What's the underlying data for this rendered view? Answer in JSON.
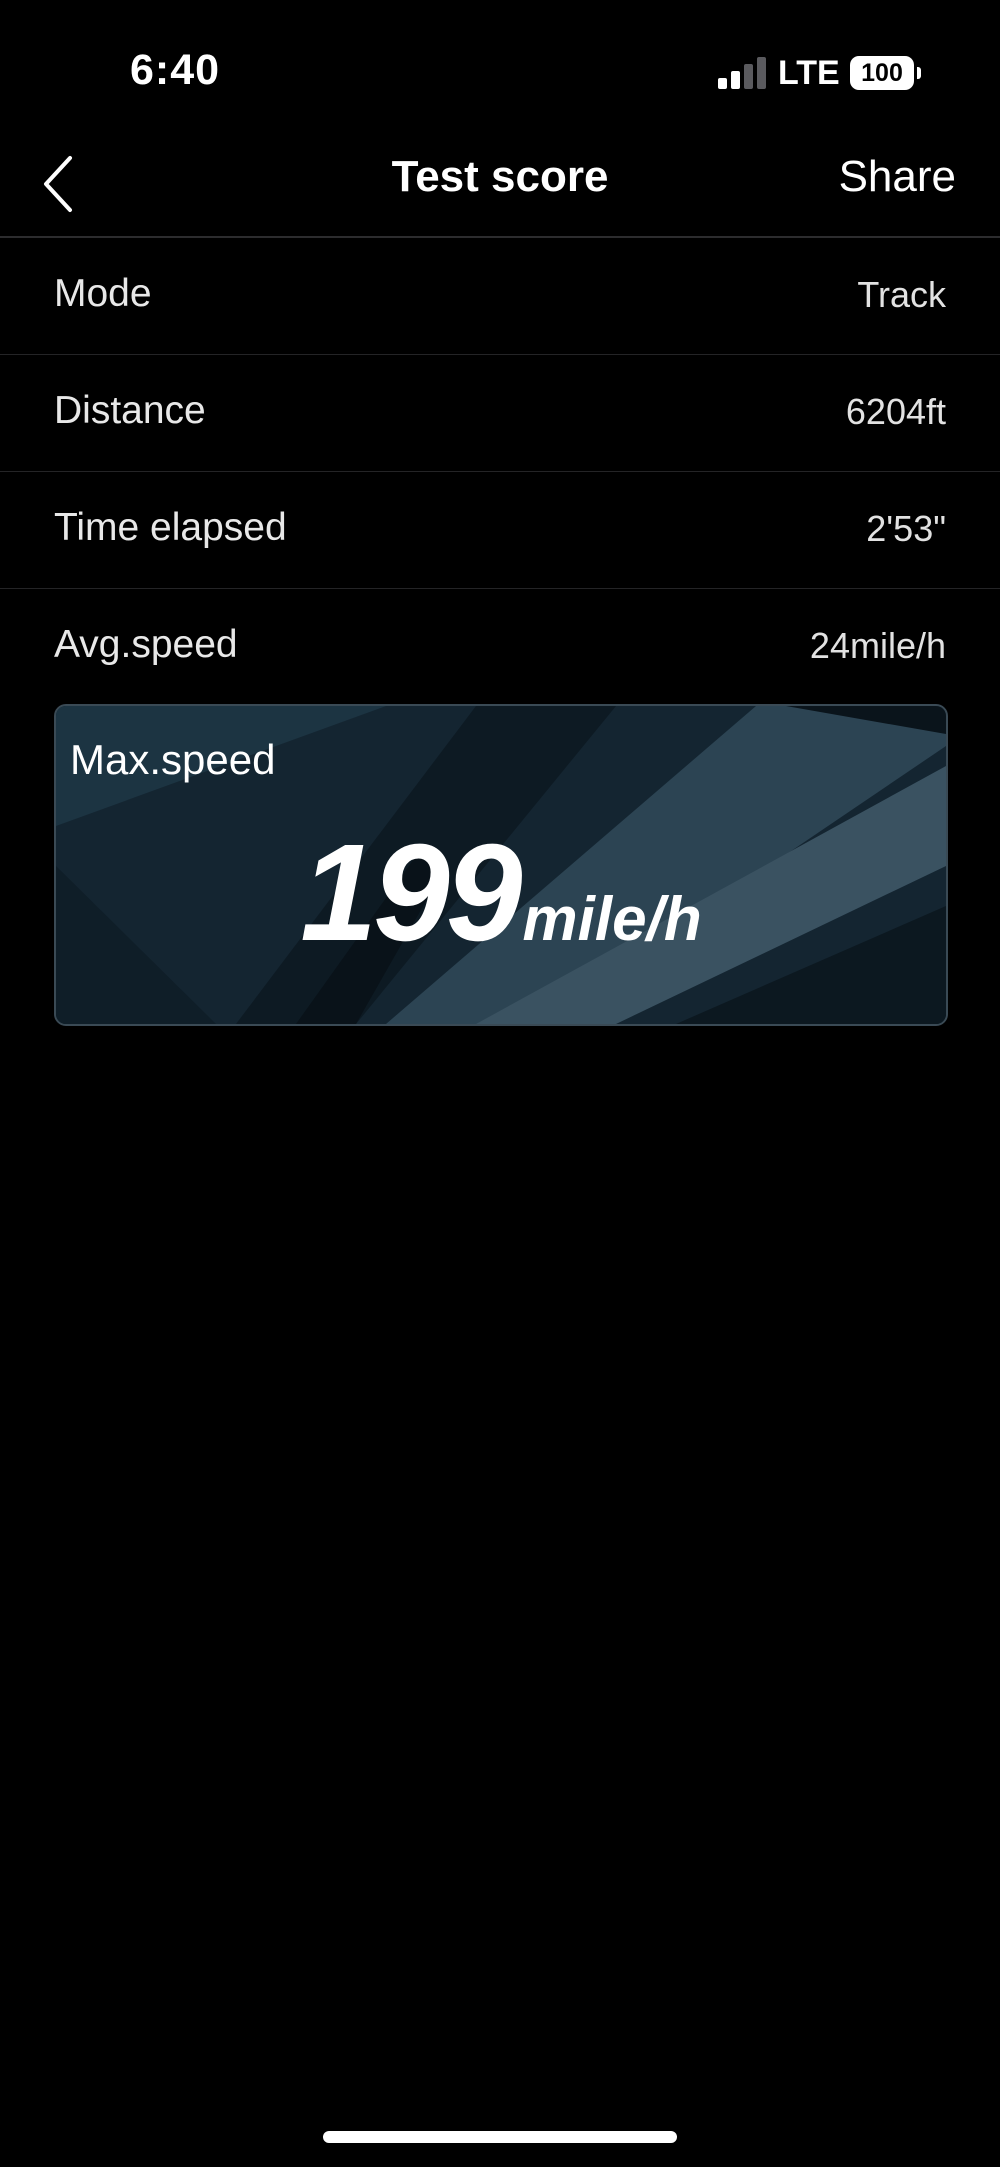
{
  "status_bar": {
    "time": "6:40",
    "network": "LTE",
    "battery": "100"
  },
  "nav": {
    "title": "Test score",
    "share_label": "Share"
  },
  "rows": [
    {
      "label": "Mode",
      "value": "Track"
    },
    {
      "label": "Distance",
      "value": "6204ft"
    },
    {
      "label": "Time elapsed",
      "value": "2'53\""
    },
    {
      "label": "Avg.speed",
      "value": "24mile/h"
    }
  ],
  "max_speed": {
    "label": "Max.speed",
    "value": "199",
    "unit": "mile/h"
  },
  "colors": {
    "background": "#000000",
    "card_background": "#13232e",
    "divider": "#2c2c2e",
    "text": "#ffffff"
  },
  "icons": [
    "chevron-left-icon",
    "signal-icon",
    "battery-icon"
  ]
}
